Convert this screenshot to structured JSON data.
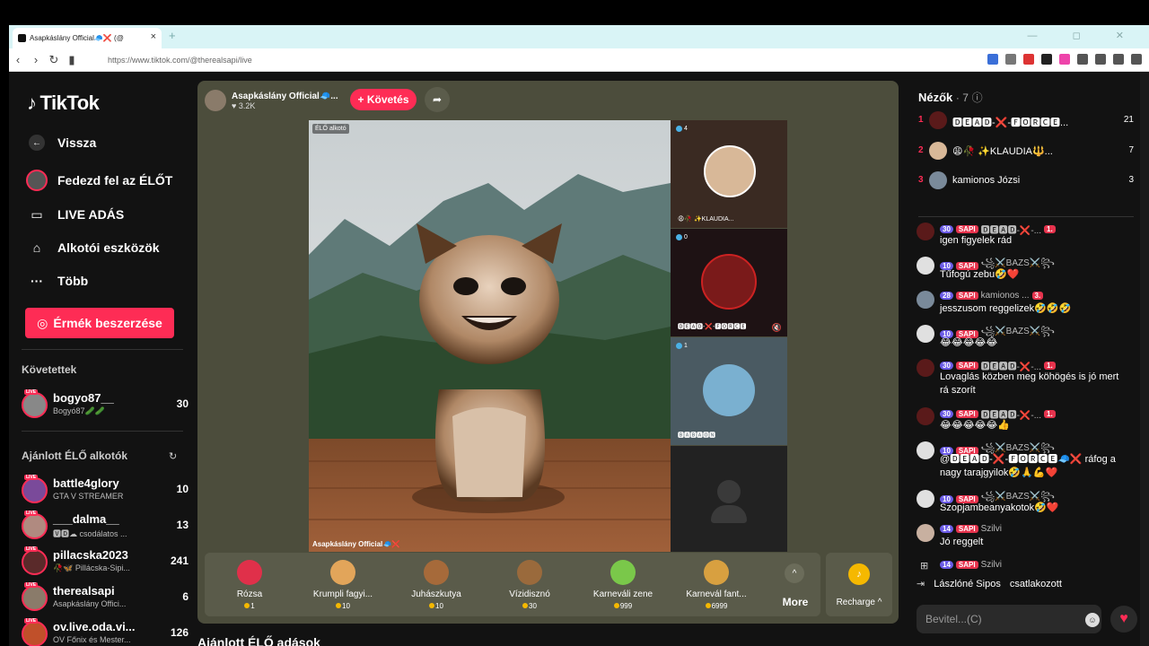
{
  "browser": {
    "tab_title": "Asapkáslány Official🧢❌ (@",
    "tab_close": "×",
    "new_tab": "+",
    "url": "https://www.tiktok.com/@therealsapi/live",
    "window_controls": "— ◻ ✕"
  },
  "sidebar": {
    "logo": "TikTok",
    "back": "Vissza",
    "explore": "Fedezd fel az ÉLŐT",
    "live": "LIVE ADÁS",
    "creator_tools": "Alkotói eszközök",
    "more": "Több",
    "coins_button": "Érmék beszerzése",
    "following_heading": "Követettek",
    "following": [
      {
        "name": "bogyo87__",
        "sub": "Bogyó87🥒🥒",
        "count": "30"
      }
    ],
    "recommended_heading": "Ajánlott ÉLŐ alkotók",
    "recommended": [
      {
        "name": "battle4glory",
        "sub": "GTA V STREAMER",
        "count": "10"
      },
      {
        "name": "___dalma__",
        "sub": "🆅🅳☁ csodálatos ...",
        "count": "13"
      },
      {
        "name": "pillacska2023",
        "sub": "🥀🦋 Pillácska-Sipi...",
        "count": "241"
      },
      {
        "name": "therealsapi",
        "sub": "Asapkáslány Offici...",
        "count": "6"
      },
      {
        "name": "ov.live.oda.vi...",
        "sub": "OV Főnix és Mester...",
        "count": "126"
      }
    ]
  },
  "stage": {
    "host_name": "Asapkáslány Official🧢...",
    "host_likes": "♥ 3.2K",
    "follow_button": "+ Követés",
    "video_label": "ÉLŐ alkotó",
    "video_caption": "Asapkáslány Official🧢❌",
    "cohosts": [
      {
        "score": "4",
        "name": "😩🥀 ✨KLAUDIA..."
      },
      {
        "score": "0",
        "name": "🅳🅴🅰🅳-❌-🅵🅾🆁🅲🅴"
      },
      {
        "score": "1",
        "name": "🅱🅰🅱🅰🅾🅽"
      }
    ],
    "gifts": [
      {
        "name": "Rózsa",
        "price": "1",
        "color": "#e0304a"
      },
      {
        "name": "Krumpli fagyi...",
        "price": "10",
        "color": "#e2a55a"
      },
      {
        "name": "Juhászkutya",
        "price": "10",
        "color": "#a66a3a"
      },
      {
        "name": "Vízidisznó",
        "price": "30",
        "color": "#9a6a3c"
      },
      {
        "name": "Karneváli zene",
        "price": "999",
        "color": "#7ac84a"
      },
      {
        "name": "Karnevál fant...",
        "price": "6999",
        "color": "#d8a040"
      }
    ],
    "more_label": "More",
    "recharge_label": "Recharge ^"
  },
  "recommended_streams_heading": "Ajánlott ÉLŐ adások",
  "chat": {
    "viewers_label": "Nézők",
    "viewers_count": "· 7",
    "top_viewers": [
      {
        "rank": "1",
        "name": "🅳🅴🅰🅳-❌-🅵🅾🆁🅲🅴...",
        "score": "21"
      },
      {
        "rank": "2",
        "name": "😩🥀 ✨KLAUDIA🔱...",
        "score": "7"
      },
      {
        "rank": "3",
        "name": "kamionos Józsi",
        "score": "3"
      }
    ],
    "messages": [
      {
        "level": "30",
        "fan": "SAPI",
        "name": "🅳🅴🅰🅳-❌-...",
        "rank": "1.",
        "text": "igen figyelek rád"
      },
      {
        "level": "10",
        "fan": "SAPI",
        "name": "꧁⚔️BAZS⚔️꧂",
        "rank": "",
        "text": "Tűfogú zebu🤣❤️"
      },
      {
        "level": "28",
        "fan": "SAPI",
        "name": "kamionos ...",
        "rank": "3.",
        "text": "jesszusom reggelizek🤣🤣🤣"
      },
      {
        "level": "10",
        "fan": "SAPI",
        "name": "꧁⚔️BAZS⚔️꧂",
        "rank": "",
        "text": "😂😂😂😂😂"
      },
      {
        "level": "30",
        "fan": "SAPI",
        "name": "🅳🅴🅰🅳-❌-...",
        "rank": "1.",
        "text": "Lovaglás közben meg köhögés is jó mert rá szorít"
      },
      {
        "level": "30",
        "fan": "SAPI",
        "name": "🅳🅴🅰🅳-❌-...",
        "rank": "1.",
        "text": "😂😂😂😂😂👍"
      },
      {
        "level": "10",
        "fan": "SAPI",
        "name": "꧁⚔️BAZS⚔️꧂",
        "rank": "",
        "text": "@🅳🅴🅰🅳-❌-🅵🅾🆁🅲🅴🧢❌ ráfog a nagy tarajgyilok🤣🙏💪❤️"
      },
      {
        "level": "10",
        "fan": "SAPI",
        "name": "꧁⚔️BAZS⚔️꧂",
        "rank": "",
        "text": "Szopjambeanyakotok🤣❤️"
      },
      {
        "level": "14",
        "fan": "SAPI",
        "name": "Szilvi",
        "rank": "",
        "text": "Jó reggelt"
      },
      {
        "level": "14",
        "fan": "SAPI",
        "name": "Szilvi",
        "rank": "",
        "text": ""
      }
    ],
    "join_name": "Lászlóné Sipos",
    "join_text": "csatlakozott",
    "input_placeholder": "Bevitel...(C)"
  }
}
